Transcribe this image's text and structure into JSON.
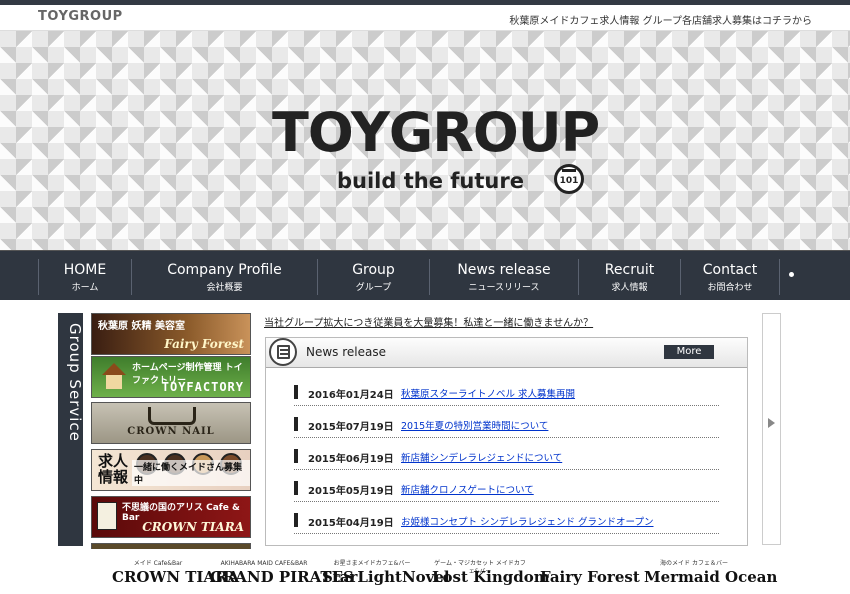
{
  "topbar": {
    "logo": "TOYGROUP",
    "tagline": "秋葉原メイドカフェ求人情報 グループ各店舗求人募集はコチラから"
  },
  "hero": {
    "brand": "TOYGROUP",
    "subtitle": "build the future",
    "emblem_text": "101"
  },
  "nav": {
    "items": [
      {
        "en": "HOME",
        "jp": "ホーム"
      },
      {
        "en": "Company  Profile",
        "jp": "会社概要"
      },
      {
        "en": "Group",
        "jp": "グループ"
      },
      {
        "en": "News release",
        "jp": "ニュースリリース"
      },
      {
        "en": "Recruit",
        "jp": "求人情報"
      },
      {
        "en": "Contact",
        "jp": "お問合わせ"
      }
    ]
  },
  "sidebar": {
    "label": "Group Service",
    "banners": [
      {
        "line1": "秋葉原 妖精 美容室",
        "line2": "Fairy Forest"
      },
      {
        "line1": "ホームページ制作管理 トイファクトリー",
        "line2": "TOYFACTORY"
      },
      {
        "line1": "",
        "line2": "CROWN NAIL"
      },
      {
        "line1": "求人情報",
        "line2": "一緒に働くメイドさん募集中"
      },
      {
        "line1": "不思議の国のアリス Cafe & Bar",
        "line2": "CROWN TIARA"
      }
    ]
  },
  "notice": "当社グループ拡大につき従業員を大量募集！私達と一緒に働きませんか？",
  "news": {
    "title": "News release",
    "more": "More",
    "items": [
      {
        "date": "2016年01月24日",
        "text": "秋葉原スターライトノベル 求人募集再開"
      },
      {
        "date": "2015年07月19日",
        "text": "2015年夏の特別営業時間について"
      },
      {
        "date": "2015年06月19日",
        "text": "新店舗シンデレラレジェンドについて"
      },
      {
        "date": "2015年05月19日",
        "text": "新店舗クロノスゲートについて"
      },
      {
        "date": "2015年04月19日",
        "text": "お姫様コンセプト シンデレラレジェンド グランドオープン"
      }
    ]
  },
  "footer_logos": [
    {
      "small": "メイド Cafe&Bar",
      "big": "CROWN TIARA"
    },
    {
      "small": "AKIHABARA MAID CAFE&BAR",
      "big": "GRAND PIRATES"
    },
    {
      "small": "お星さまメイドカフェ&バー",
      "big": "StarLightNovel"
    },
    {
      "small": "ゲーム・マジカセット メイドカフェ&バー",
      "big": "Lost Kingdom"
    },
    {
      "small": "",
      "big": "Fairy Forest"
    },
    {
      "small": "海のメイド カフェ＆バー",
      "big": "Mermaid Ocean"
    }
  ]
}
